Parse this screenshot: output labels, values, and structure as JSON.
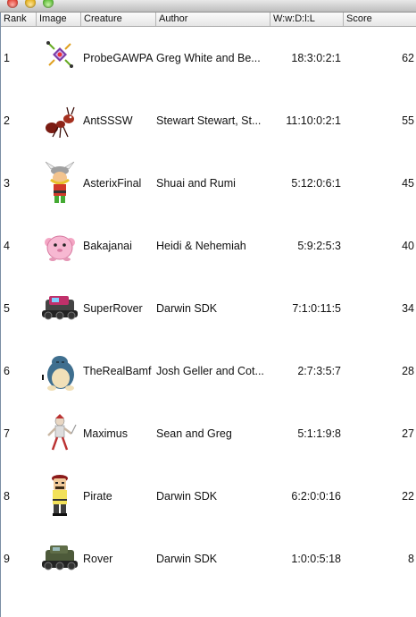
{
  "columns": {
    "rank": "Rank",
    "image": "Image",
    "creature": "Creature",
    "author": "Author",
    "wdl": "W:w:D:l:L",
    "score": "Score"
  },
  "rows": [
    {
      "rank": "1",
      "creature": "ProbeGAWPA",
      "author": "Greg White and Be...",
      "wdl": "18:3:0:2:1",
      "score": "62",
      "icon": "probe-creature-icon"
    },
    {
      "rank": "2",
      "creature": "AntSSSW",
      "author": "Stewart Stewart, St...",
      "wdl": "11:10:0:2:1",
      "score": "55",
      "icon": "ant-creature-icon"
    },
    {
      "rank": "3",
      "creature": "AsterixFinal",
      "author": "Shuai and Rumi",
      "wdl": "5:12:0:6:1",
      "score": "45",
      "icon": "asterix-creature-icon"
    },
    {
      "rank": "4",
      "creature": "Bakajanai",
      "author": "Heidi & Nehemiah",
      "wdl": "5:9:2:5:3",
      "score": "40",
      "icon": "pink-blob-creature-icon"
    },
    {
      "rank": "5",
      "creature": "SuperRover",
      "author": "Darwin SDK",
      "wdl": "7:1:0:11:5",
      "score": "34",
      "icon": "superrover-creature-icon"
    },
    {
      "rank": "6",
      "creature": "TheRealBamf",
      "author": "Josh Geller and Cot...",
      "wdl": "2:7:3:5:7",
      "score": "28",
      "icon": "snorlax-creature-icon"
    },
    {
      "rank": "7",
      "creature": "Maximus",
      "author": "Sean and Greg",
      "wdl": "5:1:1:9:8",
      "score": "27",
      "icon": "warrior-creature-icon"
    },
    {
      "rank": "8",
      "creature": "Pirate",
      "author": "Darwin SDK",
      "wdl": "6:2:0:0:16",
      "score": "22",
      "icon": "pirate-creature-icon"
    },
    {
      "rank": "9",
      "creature": "Rover",
      "author": "Darwin SDK",
      "wdl": "1:0:0:5:18",
      "score": "8",
      "icon": "rover-creature-icon"
    }
  ]
}
